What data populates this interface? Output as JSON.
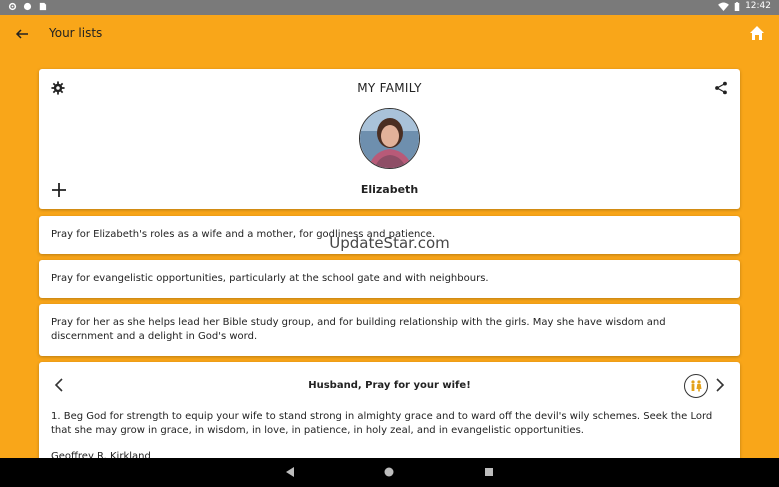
{
  "status_bar": {
    "time": "12:42",
    "left_icons": [
      "gear-icon",
      "circle-icon",
      "sim-icon"
    ],
    "right_icons": [
      "wifi-icon",
      "battery-icon"
    ]
  },
  "app_bar": {
    "title": "Your lists",
    "back_icon": "arrow-left-icon",
    "home_icon": "home-icon"
  },
  "profile_card": {
    "list_title": "MY FAMILY",
    "person_name": "Elizabeth",
    "icons": [
      "gear-icon",
      "share-icon",
      "plus-icon"
    ]
  },
  "prayers": [
    "Pray for Elizabeth's roles as a wife and a mother, for godliness and patience.",
    "Pray for evangelistic opportunities, particularly at the school gate and with neighbours.",
    "Pray for her as she helps lead her Bible study group, and for building relationship with the girls. May she have wisdom and discernment and a delight in God's word."
  ],
  "devotional": {
    "title": "Husband, Pray for your wife!",
    "body": "1. Beg God for strength to equip your wife to stand strong in almighty grace and to ward off the devil's wily schemes. Seek the Lord that she may grow in grace, in wisdom, in love, in patience, in holy zeal, and in evangelistic opportunities.",
    "author": "Geoffrey R. Kirkland"
  },
  "watermark": "UpdateStar.com",
  "colors": {
    "background": "#F9A619",
    "card": "#FFFFFF",
    "status_bar": "#7A7A7A",
    "nav_bar": "#000000"
  }
}
